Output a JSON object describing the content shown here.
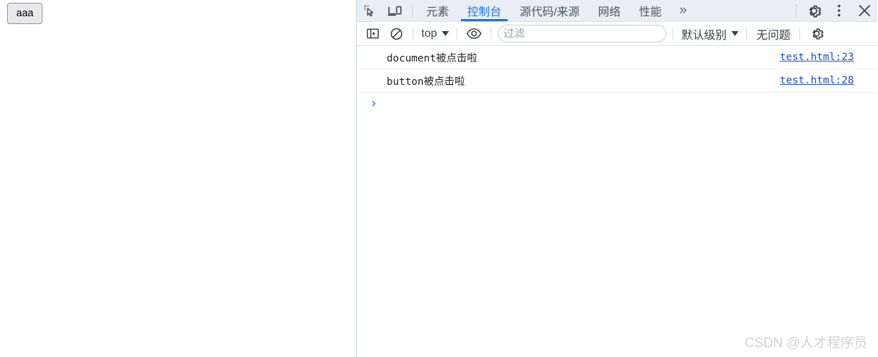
{
  "page": {
    "button_label": "aaa"
  },
  "devtools": {
    "tabstrip": {
      "inspect_icon": "inspect-element-icon",
      "device_icon": "device-toolbar-icon",
      "tabs": [
        {
          "label": "元素",
          "active": false
        },
        {
          "label": "控制台",
          "active": true
        },
        {
          "label": "源代码/来源",
          "active": false
        },
        {
          "label": "网络",
          "active": false
        },
        {
          "label": "性能",
          "active": false
        }
      ],
      "more_tabs_label": "»",
      "settings_icon": "gear-icon",
      "menu_icon": "kebab-menu-icon",
      "close_icon": "close-icon"
    },
    "console_toolbar": {
      "sidebar_icon": "console-sidebar-icon",
      "clear_icon": "clear-console-icon",
      "context_selector": "top",
      "eye_icon": "live-expression-eye-icon",
      "filter_placeholder": "过滤",
      "filter_value": "",
      "level_selector": "默认级别",
      "issues_label": "无问题",
      "settings_icon": "console-settings-gear-icon"
    },
    "messages": [
      {
        "text": "document被点击啦",
        "source": "test.html:23"
      },
      {
        "text": "button被点击啦",
        "source": "test.html:28"
      }
    ],
    "prompt": {
      "caret": "›",
      "value": ""
    }
  },
  "watermark": "CSDN @人才程序员",
  "colors": {
    "accent": "#1a73e8",
    "tabstrip_bg": "#e9edf6",
    "link": "#1a4ae0",
    "text": "#202124",
    "muted": "#9aa0a6"
  }
}
